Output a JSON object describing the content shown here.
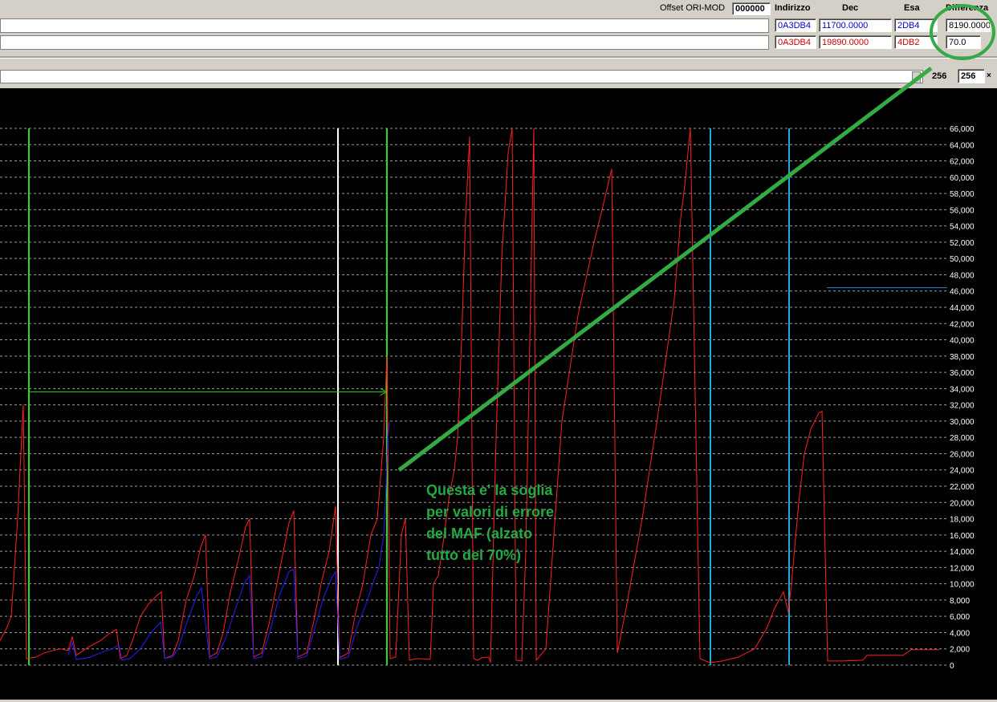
{
  "toolbar": {
    "offset_label": "Offset ORI-MOD",
    "offset_value": "000000",
    "col_indirizzo": "Indirizzo",
    "col_dec": "Dec",
    "col_esa": "Esa",
    "col_differenza": "Differenza"
  },
  "rows": [
    {
      "indirizzo": "0A3DB4",
      "dec": "11700.0000",
      "esa": "2DB4",
      "differenza": "8190.0000",
      "color": "#0000cc"
    },
    {
      "indirizzo": "0A3DB4",
      "dec": "19890.0000",
      "esa": "4DB2",
      "differenza": "70.0",
      "color": "#cc0000"
    }
  ],
  "scroll": {
    "label_value": "256",
    "input_value": "256",
    "close_glyph": "×"
  },
  "annotation": {
    "lines": [
      "Questa e' la soglia",
      "per valori di errore",
      "del MAF (alzato",
      "tutto del 70%)"
    ],
    "color": "#22aa44"
  },
  "chart_data": {
    "type": "line",
    "y_ticks": [
      "0",
      "2,000",
      "4,000",
      "6,000",
      "8,000",
      "10,000",
      "12,000",
      "14,000",
      "16,000",
      "18,000",
      "20,000",
      "22,000",
      "24,000",
      "26,000",
      "28,000",
      "30,000",
      "32,000",
      "34,000",
      "36,000",
      "38,000",
      "40,000",
      "42,000",
      "44,000",
      "46,000",
      "48,000",
      "50,000",
      "52,000",
      "54,000",
      "56,000",
      "58,000",
      "60,000",
      "62,000",
      "64,000",
      "66,000"
    ],
    "ylim": [
      0,
      66000
    ],
    "xlim": [
      0,
      1180
    ],
    "grid": true,
    "series": [
      {
        "color": "#ff2020",
        "points": [
          [
            0,
            3000
          ],
          [
            8,
            4500
          ],
          [
            14,
            6000
          ],
          [
            22,
            18000
          ],
          [
            29,
            32000
          ],
          [
            33,
            800
          ],
          [
            45,
            1000
          ],
          [
            55,
            1500
          ],
          [
            62,
            1700
          ],
          [
            75,
            2000
          ],
          [
            85,
            1800
          ],
          [
            90,
            3500
          ],
          [
            95,
            1200
          ],
          [
            110,
            2200
          ],
          [
            125,
            3000
          ],
          [
            135,
            3800
          ],
          [
            145,
            4400
          ],
          [
            150,
            800
          ],
          [
            158,
            1200
          ],
          [
            165,
            3000
          ],
          [
            175,
            6000
          ],
          [
            185,
            7500
          ],
          [
            195,
            8500
          ],
          [
            201,
            9000
          ],
          [
            205,
            800
          ],
          [
            215,
            1200
          ],
          [
            222,
            3000
          ],
          [
            232,
            8000
          ],
          [
            242,
            11000
          ],
          [
            250,
            14500
          ],
          [
            256,
            16000
          ],
          [
            261,
            1000
          ],
          [
            270,
            1500
          ],
          [
            278,
            4000
          ],
          [
            287,
            9000
          ],
          [
            297,
            13000
          ],
          [
            306,
            17000
          ],
          [
            311,
            18000
          ],
          [
            316,
            1000
          ],
          [
            326,
            1500
          ],
          [
            335,
            5000
          ],
          [
            344,
            9500
          ],
          [
            352,
            13500
          ],
          [
            360,
            17500
          ],
          [
            366,
            19000
          ],
          [
            371,
            1000
          ],
          [
            382,
            1500
          ],
          [
            390,
            5000
          ],
          [
            400,
            10000
          ],
          [
            410,
            14000
          ],
          [
            418,
            19500
          ],
          [
            423,
            900
          ],
          [
            434,
            1500
          ],
          [
            442,
            6000
          ],
          [
            452,
            10000
          ],
          [
            462,
            16000
          ],
          [
            470,
            18000
          ],
          [
            478,
            28000
          ],
          [
            482,
            38000
          ],
          [
            486,
            800
          ],
          [
            493,
            1000
          ],
          [
            500,
            16000
          ],
          [
            505,
            18000
          ],
          [
            510,
            600
          ],
          [
            520,
            800
          ],
          [
            536,
            700
          ],
          [
            540,
            10000
          ],
          [
            546,
            11000
          ],
          [
            552,
            15000
          ],
          [
            560,
            21000
          ],
          [
            566,
            24000
          ],
          [
            570,
            28000
          ],
          [
            575,
            40000
          ],
          [
            580,
            55000
          ],
          [
            585,
            65000
          ],
          [
            590,
            800
          ],
          [
            595,
            600
          ],
          [
            600,
            900
          ],
          [
            609,
            1000
          ],
          [
            611,
            300
          ],
          [
            618,
            28000
          ],
          [
            625,
            50000
          ],
          [
            633,
            63000
          ],
          [
            638,
            66000
          ],
          [
            643,
            600
          ],
          [
            650,
            500
          ],
          [
            655,
            14000
          ],
          [
            660,
            40000
          ],
          [
            665,
            66000
          ],
          [
            668,
            600
          ],
          [
            680,
            2000
          ],
          [
            700,
            30000
          ],
          [
            720,
            43000
          ],
          [
            740,
            52000
          ],
          [
            750,
            56000
          ],
          [
            762,
            61000
          ],
          [
            769,
            1500
          ],
          [
            780,
            7000
          ],
          [
            800,
            18000
          ],
          [
            820,
            31000
          ],
          [
            840,
            45000
          ],
          [
            848,
            55000
          ],
          [
            853,
            59000
          ],
          [
            860,
            66000
          ],
          [
            872,
            800
          ],
          [
            884,
            300
          ],
          [
            900,
            500
          ],
          [
            920,
            1000
          ],
          [
            940,
            2000
          ],
          [
            955,
            4500
          ],
          [
            965,
            7000
          ],
          [
            976,
            9000
          ],
          [
            982,
            6500
          ],
          [
            986,
            10000
          ],
          [
            995,
            20000
          ],
          [
            1002,
            26000
          ],
          [
            1010,
            29000
          ],
          [
            1020,
            31000
          ],
          [
            1024,
            31200
          ],
          [
            1031,
            500
          ],
          [
            1050,
            500
          ],
          [
            1075,
            600
          ],
          [
            1080,
            1200
          ],
          [
            1110,
            1200
          ],
          [
            1125,
            1200
          ],
          [
            1135,
            1900
          ],
          [
            1150,
            1900
          ],
          [
            1170,
            1900
          ]
        ]
      },
      {
        "color": "#2020ff",
        "points": [
          [
            85,
            1200
          ],
          [
            90,
            2800
          ],
          [
            95,
            700
          ],
          [
            110,
            900
          ],
          [
            125,
            1500
          ],
          [
            140,
            2000
          ],
          [
            148,
            2500
          ],
          [
            152,
            600
          ],
          [
            162,
            800
          ],
          [
            175,
            2000
          ],
          [
            188,
            4000
          ],
          [
            200,
            5300
          ],
          [
            205,
            800
          ],
          [
            215,
            1000
          ],
          [
            222,
            2000
          ],
          [
            232,
            5000
          ],
          [
            245,
            8500
          ],
          [
            251,
            9500
          ],
          [
            261,
            800
          ],
          [
            270,
            1000
          ],
          [
            280,
            3000
          ],
          [
            292,
            6500
          ],
          [
            304,
            10000
          ],
          [
            311,
            11000
          ],
          [
            316,
            800
          ],
          [
            326,
            1000
          ],
          [
            336,
            4000
          ],
          [
            348,
            8500
          ],
          [
            360,
            11500
          ],
          [
            366,
            11800
          ],
          [
            371,
            800
          ],
          [
            382,
            1100
          ],
          [
            392,
            4500
          ],
          [
            402,
            8000
          ],
          [
            412,
            10500
          ],
          [
            418,
            11500
          ],
          [
            423,
            700
          ],
          [
            434,
            1000
          ],
          [
            444,
            4500
          ],
          [
            456,
            7500
          ],
          [
            466,
            10500
          ],
          [
            472,
            12000
          ],
          [
            478,
            16000
          ],
          [
            481,
            22000
          ],
          [
            483,
            28000
          ],
          [
            485,
            30000
          ]
        ]
      }
    ],
    "vlines": [
      {
        "x": 36,
        "color": "#22dd22"
      },
      {
        "x": 421,
        "color": "#ffffff"
      },
      {
        "x": 482,
        "color": "#22dd22"
      },
      {
        "x": 885,
        "color": "#22aadd"
      },
      {
        "x": 983,
        "color": "#22aadd"
      }
    ],
    "hline_marker": {
      "x1": 36,
      "x2": 482,
      "y": 33600,
      "color": "#22dd22"
    },
    "blue_segment": {
      "x1": 1030,
      "x2": 1180,
      "y": 46400,
      "color": "#2288dd"
    }
  }
}
